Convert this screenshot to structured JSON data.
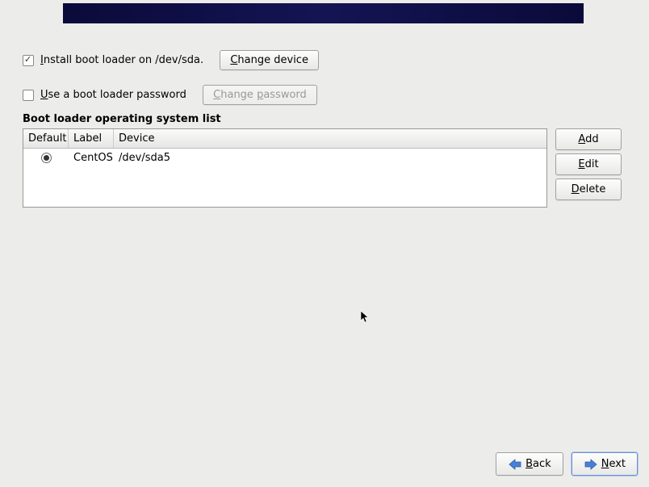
{
  "install_bootloader": {
    "checked": true,
    "label_prefix": "I",
    "label_rest": "nstall boot loader on /dev/sda.",
    "change_device_u": "C",
    "change_device_rest": "hange device"
  },
  "use_password": {
    "checked": false,
    "label_prefix": "U",
    "label_rest": "se a boot loader password",
    "change_password_text": "Change password"
  },
  "section_title": "Boot loader operating system list",
  "table": {
    "headers": {
      "default": "Default",
      "label": "Label",
      "device": "Device"
    },
    "rows": [
      {
        "default_selected": true,
        "label": "CentOS",
        "device": "/dev/sda5"
      }
    ]
  },
  "side_buttons": {
    "add_u": "A",
    "add_rest": "dd",
    "edit_u": "E",
    "edit_rest": "dit",
    "delete_u": "D",
    "delete_rest": "elete"
  },
  "footer": {
    "back_u": "B",
    "back_rest": "ack",
    "next_u": "N",
    "next_rest": "ext"
  }
}
